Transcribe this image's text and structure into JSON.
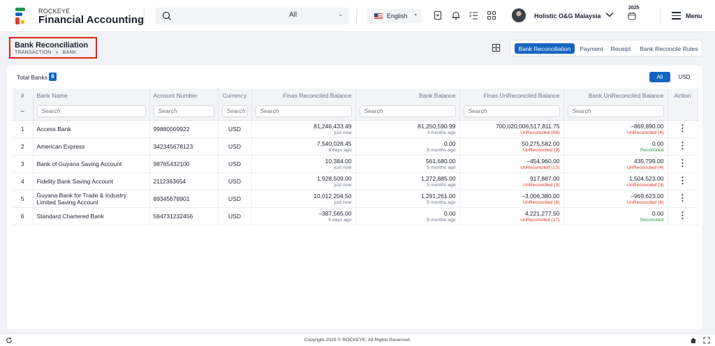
{
  "app": {
    "brand_top": "ROCKEYE",
    "brand_main": "Financial Accounting"
  },
  "topbar": {
    "search_filter": "All",
    "language": "English",
    "company": "Holistic O&G Malaysia",
    "year": "2025",
    "menu_label": "Menu"
  },
  "page": {
    "title": "Bank Reconciliation",
    "breadcrumb_1": "TRANSACTION",
    "breadcrumb_sep": "»",
    "breadcrumb_2": "BANK"
  },
  "tabs": [
    {
      "label": "Bank Reconciliation",
      "active": true
    },
    {
      "label": "Payment",
      "active": false
    },
    {
      "label": "Receipt",
      "active": false
    },
    {
      "label": "Bank Reconcile Rules",
      "active": false
    }
  ],
  "summary": {
    "label": "Total Banks",
    "count": "6"
  },
  "currency_toggle": {
    "options": [
      "All",
      "USD"
    ],
    "selected": "All"
  },
  "table": {
    "headers": [
      "#",
      "Bank Name",
      "Account Number",
      "Currency",
      "Finas Reconciled Balance",
      "Bank Balance",
      "Finas UnReconciled Balance",
      "Bank UnReconciled Balance",
      "Action"
    ],
    "filter_first": "–",
    "filter_placeholder": "Search",
    "rows": [
      {
        "no": "1",
        "bank": "Access Bank",
        "account": "99880009922",
        "currency": "USD",
        "finas_rec": "81,246,433.49",
        "finas_rec_sub": "just now",
        "bank_bal": "81,250,590.99",
        "bank_bal_sub": "3 months ago",
        "finas_unrec": "700,020,006,517,811.75",
        "finas_unrec_sub": "UnReconciled (68)",
        "bank_unrec": "–869,890.00",
        "bank_unrec_sub": "UnReconciled (4)",
        "bank_unrec_status": "red"
      },
      {
        "no": "2",
        "bank": "American Express",
        "account": "342345678123",
        "currency": "USD",
        "finas_rec": "7,540,028.45",
        "finas_rec_sub": "3 days ago",
        "bank_bal": "0.00",
        "bank_bal_sub": "6 months ago",
        "finas_unrec": "50,275,582.00",
        "finas_unrec_sub": "UnReconciled (9)",
        "bank_unrec": "0.00",
        "bank_unrec_sub": "Reconciled",
        "bank_unrec_status": "green"
      },
      {
        "no": "3",
        "bank": "Bank of Guyana Saving Account",
        "account": "98765432100",
        "currency": "USD",
        "finas_rec": "10,384.00",
        "finas_rec_sub": "just now",
        "bank_bal": "561,680.00",
        "bank_bal_sub": "5 months ago",
        "finas_unrec": "–454,960.00",
        "finas_unrec_sub": "UnReconciled (13)",
        "bank_unrec": "435,799.00",
        "bank_unrec_sub": "UnReconciled (4)",
        "bank_unrec_status": "red"
      },
      {
        "no": "4",
        "bank": "Fidelity Bank Saving Account",
        "account": "2112363654",
        "currency": "USD",
        "finas_rec": "1,928,509.00",
        "finas_rec_sub": "just now",
        "bank_bal": "1,272,885.00",
        "bank_bal_sub": "5 months ago",
        "finas_unrec": "917,887.00",
        "finas_unrec_sub": "UnReconciled (3)",
        "bank_unrec": "1,504,523.00",
        "bank_unrec_sub": "UnReconciled (3)",
        "bank_unrec_status": "red"
      },
      {
        "no": "5",
        "bank": "Guyana Bank for Trade & Industry Limited Saving Account",
        "account": "89345678901",
        "currency": "USD",
        "finas_rec": "10,012,204.50",
        "finas_rec_sub": "just now",
        "bank_bal": "1,291,261.00",
        "bank_bal_sub": "5 months ago",
        "finas_unrec": "–3,006,380.00",
        "finas_unrec_sub": "UnReconciled (8)",
        "bank_unrec": "–969,623.00",
        "bank_unrec_sub": "UnReconciled (6)",
        "bank_unrec_status": "red"
      },
      {
        "no": "6",
        "bank": "Standard Chartered Bank",
        "account": "564731232456",
        "currency": "USD",
        "finas_rec": "–387,565.00",
        "finas_rec_sub": "5 days ago",
        "bank_bal": "0.00",
        "bank_bal_sub": "6 months ago",
        "finas_unrec": "4,221,277.50",
        "finas_unrec_sub": "UnReconciled (17)",
        "bank_unrec": "0.00",
        "bank_unrec_sub": "Reconciled",
        "bank_unrec_status": "green"
      }
    ]
  },
  "footer": {
    "copyright": "Copyright 2025 © ROCKEYE. All Rights Reserved."
  },
  "colors": {
    "accent": "#1565c0",
    "unreconciled": "#e0311f",
    "reconciled": "#1f9a4a",
    "highlight_border": "#e02020"
  },
  "icons": {
    "search": "search-icon",
    "bookmark": "bookmark-icon",
    "notification": "bell-icon",
    "tasks": "checklist-icon",
    "apps": "apps-grid-icon",
    "calendar": "calendar-icon",
    "menu": "hamburger-icon",
    "row_action": "kebab-icon"
  }
}
